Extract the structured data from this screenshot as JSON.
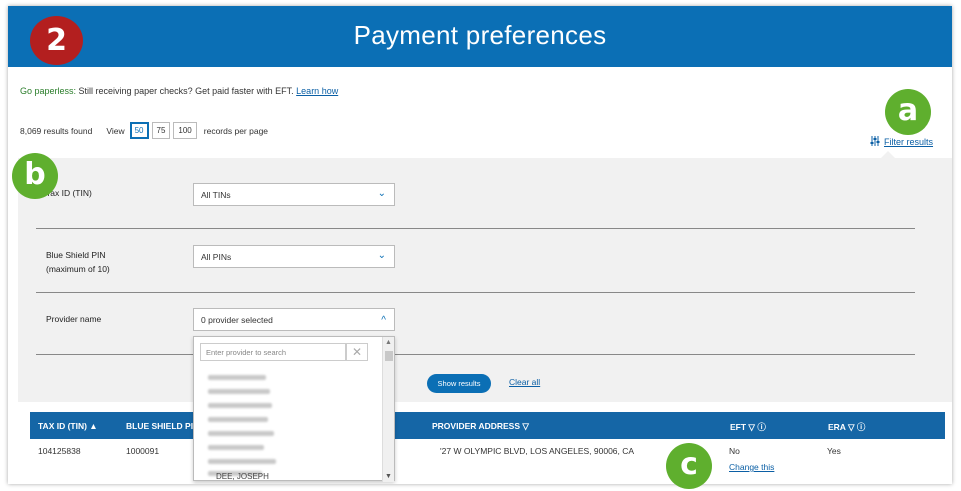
{
  "header": {
    "title": "Payment preferences",
    "step_badge": "2"
  },
  "paperless": {
    "lead": "Go paperless:",
    "text": "Still receiving paper checks? Get paid faster with EFT.",
    "link": "Learn how"
  },
  "results": {
    "count": "8,069 results found",
    "view_label": "View",
    "page_sizes": [
      "50",
      "75",
      "100"
    ],
    "selected_page_size": "50",
    "records_label": "records per page"
  },
  "filter_link": {
    "label": "Filter results",
    "icon": "filter-sliders-icon"
  },
  "filters": {
    "tin": {
      "label": "Tax ID (TIN)",
      "value": "All TINs"
    },
    "pin": {
      "label_line1": "Blue Shield PIN",
      "label_line2": "(maximum of 10)",
      "value": "All PINs"
    },
    "provider": {
      "label": "Provider name",
      "value": "0 provider selected",
      "search_placeholder": "Enter provider to search",
      "partial_visible_item": "DEE, JOSEPH"
    }
  },
  "buttons": {
    "show_results": "Show results",
    "clear_all": "Clear all"
  },
  "table": {
    "headers": {
      "tin": "TAX ID (TIN) ▲",
      "pin": "BLUE SHIELD PIN",
      "address": "PROVIDER ADDRESS ▽",
      "eft": "EFT ▽ ⓘ",
      "era": "ERA ▽ ⓘ"
    },
    "rows": [
      {
        "tin": "104125838",
        "pin": "1000091",
        "address": "'27 W OLYMPIC BLVD, LOS ANGELES, 90006, CA",
        "eft": "No",
        "eft_action": "Change this",
        "era": "Yes"
      }
    ]
  },
  "callouts": {
    "a": "a",
    "b": "b",
    "c": "c"
  },
  "colors": {
    "header_blue": "#0b6fb5",
    "badge_red": "#b31f1f",
    "badge_green": "#5faf2e"
  }
}
